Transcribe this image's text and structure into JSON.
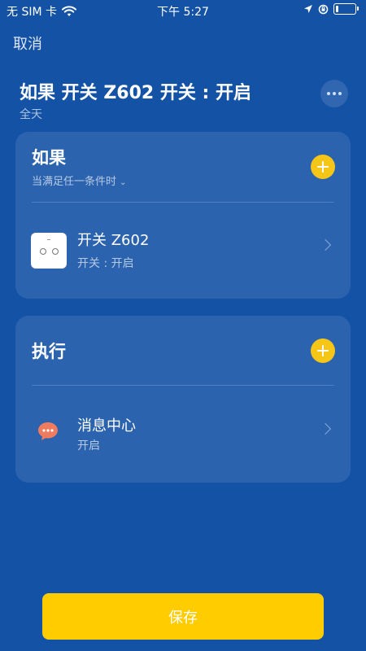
{
  "status_bar": {
    "carrier": "无 SIM 卡",
    "time": "下午 5:27",
    "battery_level": 0.15
  },
  "nav": {
    "cancel_label": "取消"
  },
  "header": {
    "title": "如果 开关 Z602 开关 : 开启",
    "subtitle": "全天"
  },
  "condition_card": {
    "heading": "如果",
    "mode": "当满足任一条件时",
    "items": [
      {
        "title": "开关 Z602",
        "subtitle": "开关 : 开启",
        "icon": "switch-device-icon"
      }
    ]
  },
  "action_card": {
    "heading": "执行",
    "items": [
      {
        "title": "消息中心",
        "subtitle": "开启",
        "icon": "message-center-icon"
      }
    ]
  },
  "footer": {
    "save_label": "保存"
  },
  "colors": {
    "background": "#1452a6",
    "accent": "#ffcc00",
    "add_button": "#f5c518",
    "message_icon": "#f07b5e"
  }
}
